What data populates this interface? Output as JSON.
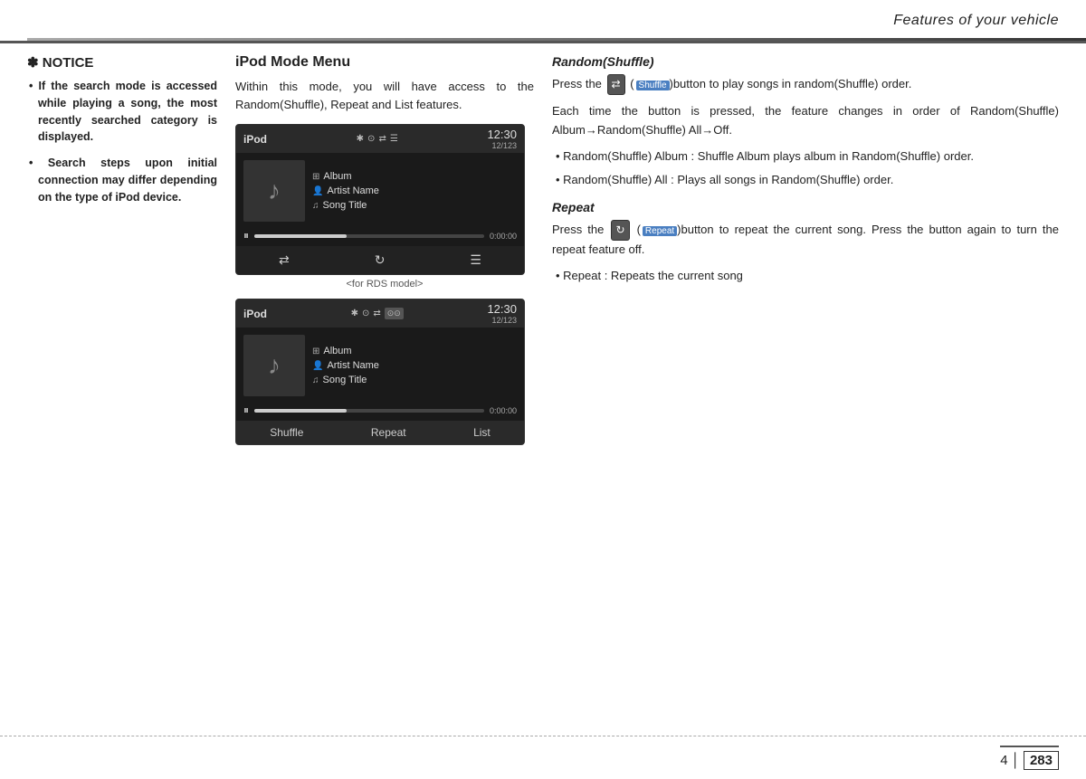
{
  "header": {
    "title": "Features of your vehicle"
  },
  "notice": {
    "title": "✽ NOTICE",
    "bullet_symbol": "•",
    "items": [
      "If the search mode is accessed while playing a song, the most recently searched category is displayed.",
      "Search steps upon initial connection may differ depending on the type of iPod device."
    ]
  },
  "ipod_section": {
    "title": "iPod Mode Menu",
    "intro": "Within this mode, you will have access to the Random(Shuffle), Repeat and List features.",
    "screen1": {
      "label": "iPod",
      "time": "12:30",
      "track_count": "12/123",
      "album": "Album",
      "artist": "Artist Name",
      "song": "Song Title",
      "progress_time": "0:00:00",
      "icons": "✱ ⊙ ⇄ ☰"
    },
    "screen2": {
      "label": "iPod",
      "time": "12:30",
      "track_count": "12/123",
      "album": "Album",
      "artist": "Artist Name",
      "song": "Song Title",
      "progress_time": "0:00:00",
      "icons": "✱ ⊙ ⇄ ☰",
      "bottom_buttons": [
        "Shuffle",
        "Repeat",
        "List"
      ]
    },
    "for_rds": "<for RDS model>"
  },
  "random_section": {
    "title": "Random(Shuffle)",
    "intro": "Press the  (Shuffle)button to play songs in random(Shuffle) order.",
    "body1": "Each time the button is pressed, the feature changes in order of Random(Shuffle)  Album→Random(Shuffle) All→Off.",
    "bullets": [
      "Random(Shuffle) Album : Shuffle Album plays album in Random(Shuffle) order.",
      "Random(Shuffle) All : Plays all songs in Random(Shuffle) order."
    ]
  },
  "repeat_section": {
    "title": "Repeat",
    "intro": "Press the  (Repeat)button to repeat the current song. Press the button again to turn the repeat feature off.",
    "bullets": [
      "Repeat : Repeats the current song"
    ]
  },
  "footer": {
    "page_section": "4",
    "page_number": "283"
  }
}
